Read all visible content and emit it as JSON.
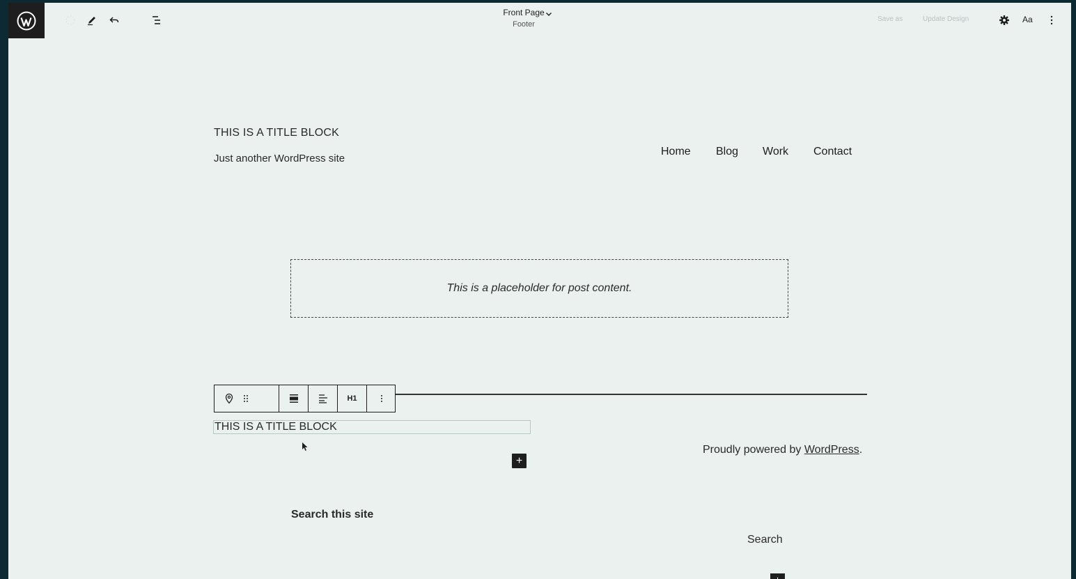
{
  "topbar": {
    "document_title": "Front Page",
    "document_subtitle": "Footer",
    "faint_left": "Save as",
    "faint_right": "Update Design",
    "typography_label": "Aa"
  },
  "site": {
    "title": "THIS IS A TITLE BLOCK",
    "tagline": "Just another WordPress site",
    "nav": [
      "Home",
      "Blog",
      "Work",
      "Contact"
    ]
  },
  "content": {
    "placeholder": "This is a placeholder for post content."
  },
  "block_toolbar": {
    "heading_level": "H1"
  },
  "footer": {
    "editing_title": "THIS IS A TITLE BLOCK",
    "powered_prefix": "Proudly powered by ",
    "powered_link": "WordPress",
    "powered_suffix": ".",
    "search_heading": "Search this site",
    "search_label": "Search",
    "add_symbol": "+"
  },
  "colors": {
    "frame": "#0d2a33",
    "canvas": "#eaf1ee",
    "dark": "#1e1e1e"
  }
}
